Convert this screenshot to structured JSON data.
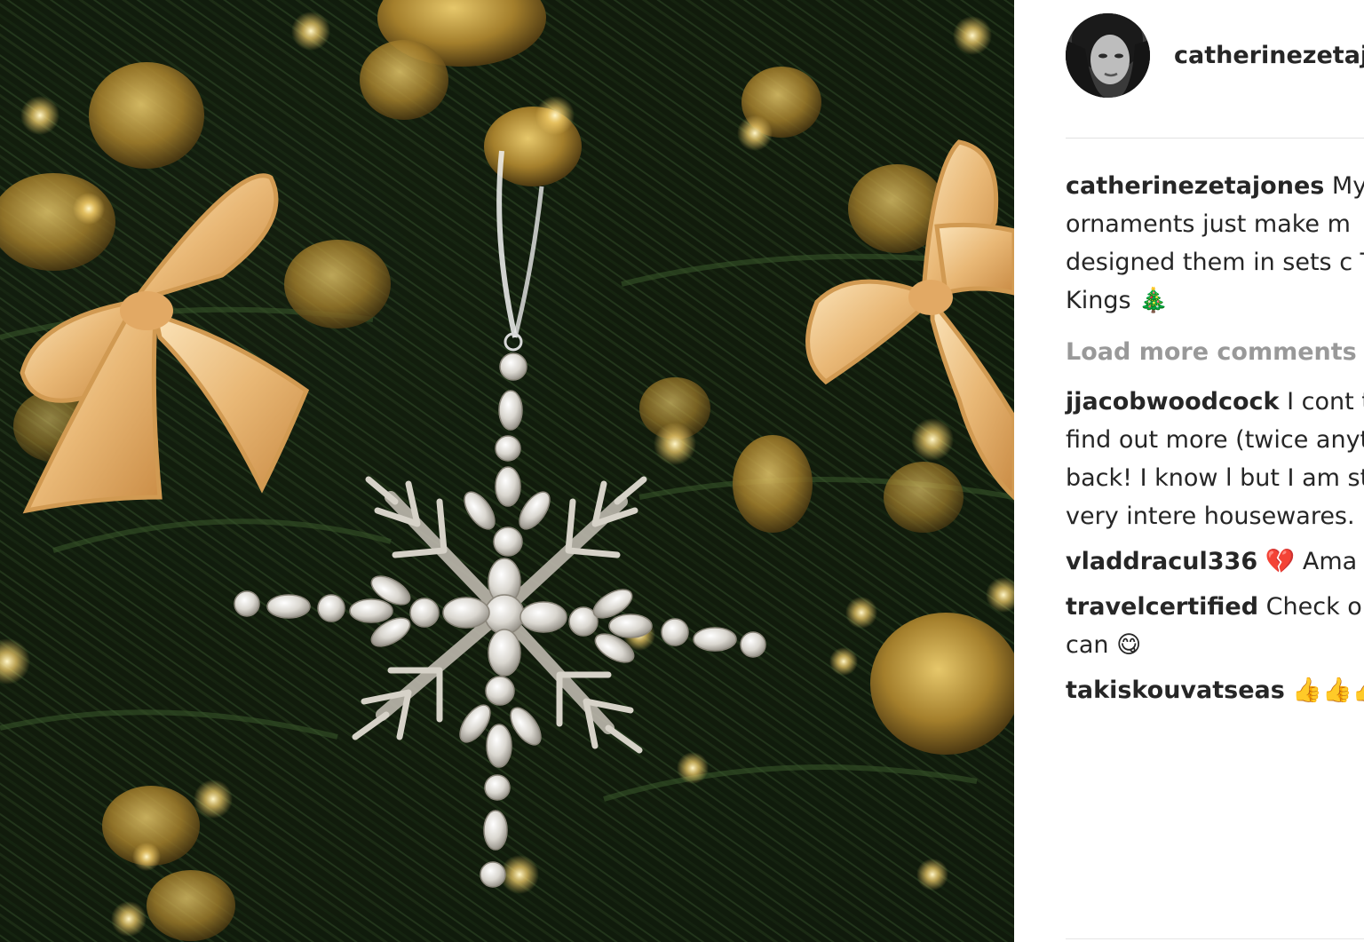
{
  "post": {
    "username": "catherinezetaj"
  },
  "comments": {
    "caption": {
      "user": "catherinezetajones",
      "text": " My ornaments just make m designed them in sets c Three Kings ",
      "emoji": "🎄"
    },
    "load_more": "Load more comments",
    "items": [
      {
        "user": "jjacobwoodcock",
        "text": " I cont to find out more (twice anything back! I know l but I am still very intere housewares.",
        "emoji": ""
      },
      {
        "user": "vladdracul336",
        "text": " Ama",
        "emoji": "💔"
      },
      {
        "user": "travelcertified",
        "text": " Check o you can ",
        "emoji": "😋"
      },
      {
        "user": "takiskouvatseas",
        "text": " ",
        "emoji": "👍👍👍"
      }
    ]
  },
  "colors": {
    "username": "#262626",
    "muted": "#999999",
    "divider": "#e2e2e2",
    "tree_dark": "#0f1a0c",
    "ribbon": "#e8b77a"
  },
  "icons": [
    "avatar-photo",
    "christmas-tree-emoji",
    "broken-heart-emoji",
    "yum-emoji",
    "thumbs-up-emoji"
  ]
}
